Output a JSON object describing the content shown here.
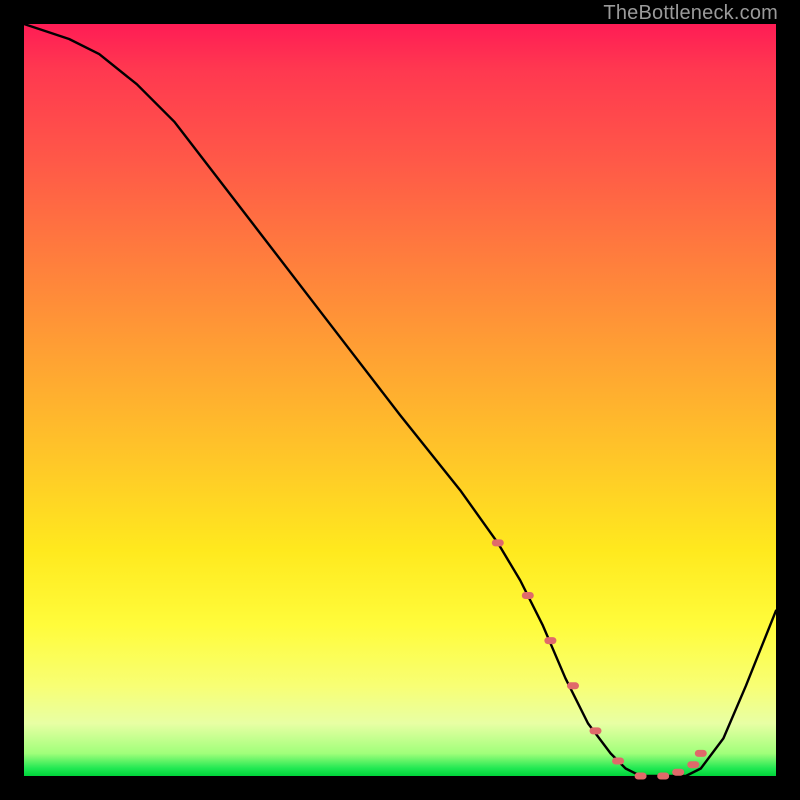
{
  "attribution": "TheBottleneck.com",
  "chart_data": {
    "type": "line",
    "title": "",
    "xlabel": "",
    "ylabel": "",
    "xlim": [
      0,
      100
    ],
    "ylim": [
      0,
      100
    ],
    "series": [
      {
        "name": "bottleneck-curve",
        "x": [
          0,
          3,
          6,
          10,
          15,
          20,
          30,
          40,
          50,
          58,
          63,
          66,
          69,
          72,
          75,
          78,
          80,
          82,
          84,
          86,
          88,
          90,
          93,
          96,
          100
        ],
        "y": [
          100,
          99,
          98,
          96,
          92,
          87,
          74,
          61,
          48,
          38,
          31,
          26,
          20,
          13,
          7,
          3,
          1,
          0,
          0,
          0,
          0,
          1,
          5,
          12,
          22
        ]
      }
    ],
    "markers": {
      "name": "highlight-dots",
      "x": [
        63,
        67,
        70,
        73,
        76,
        79,
        82,
        85,
        87,
        89,
        90
      ],
      "y": [
        31,
        24,
        18,
        12,
        6,
        2,
        0,
        0,
        0.5,
        1.5,
        3
      ]
    },
    "colors": {
      "curve": "#000000",
      "markers": "#e06a6a",
      "gradient_top": "#ff1c55",
      "gradient_bottom": "#00d43a"
    }
  }
}
